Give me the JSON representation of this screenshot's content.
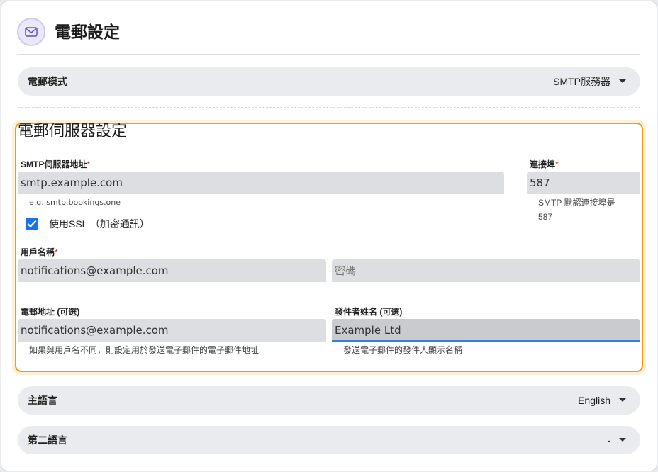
{
  "header": {
    "icon": "mail-icon",
    "title": "電郵設定"
  },
  "email_mode": {
    "label": "電郵模式",
    "value": "SMTP服務器"
  },
  "smtp_section": {
    "title": "電郵伺服器設定",
    "host": {
      "label": "SMTP伺服器地址",
      "required_mark": "*",
      "value": "smtp.example.com",
      "hint": "e.g. smtp.bookings.one"
    },
    "port": {
      "label": "連接埠",
      "required_mark": "*",
      "value": "587",
      "hint_line1": "SMTP 默認連接埠是",
      "hint_line2": "587"
    },
    "ssl": {
      "checked": true,
      "label": "使用SSL （加密通訊）"
    },
    "username": {
      "label": "用戶名稱",
      "required_mark": "*",
      "value": "notifications@example.com"
    },
    "password": {
      "placeholder": "密碼"
    },
    "email_address": {
      "label": "電郵地址 (可選)",
      "value": "notifications@example.com",
      "hint": "如果與用戶名不同，則設定用於發送電子郵件的電子郵件地址"
    },
    "sender_name": {
      "label": "發件者姓名 (可選)",
      "value": "Example Ltd",
      "hint": "發送電子郵件的發件人顯示名稱"
    }
  },
  "primary_language": {
    "label": "主語言",
    "value": "English"
  },
  "secondary_language": {
    "label": "第二語言",
    "value": "-"
  },
  "colors": {
    "accent_border": "#f39a12",
    "checkbox": "#1a73e8",
    "focus_underline": "#2f7fd6",
    "required": "#d0332a"
  }
}
